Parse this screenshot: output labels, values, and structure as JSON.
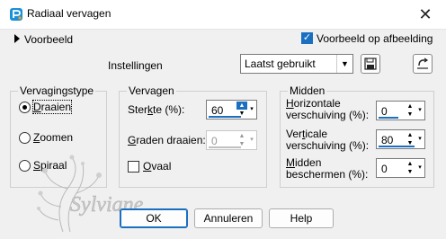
{
  "window": {
    "title": "Radiaal vervagen",
    "close_glyph": "✕",
    "icon": "paintshop-pro-icon"
  },
  "preview": {
    "toggle_label": "Voorbeeld",
    "on_image_label": "Voorbeeld op afbeelding",
    "on_image_checked": true
  },
  "settings": {
    "label": "Instellingen",
    "preset_value": "Laatst gebruikt",
    "save_icon": "save-icon",
    "reset_icon": "reset-icon"
  },
  "blur_type": {
    "title": "Vervagingstype",
    "options": [
      {
        "label_u": "D",
        "label_rest": "raaien",
        "checked": true
      },
      {
        "label_u": "Z",
        "label_rest": "oomen",
        "checked": false
      },
      {
        "label_u": "S",
        "label_rest": "piraal",
        "checked": false
      }
    ]
  },
  "blur": {
    "title": "Vervagen",
    "strength_label_pre": "Ster",
    "strength_label_u": "k",
    "strength_label_post": "te (%):",
    "strength_value": "60",
    "twist_label_u": "G",
    "twist_label_post": "raden draaien:",
    "twist_value": "0",
    "oval_label_u": "O",
    "oval_label_post": "vaal",
    "oval_checked": false
  },
  "center": {
    "title": "Midden",
    "h_offset_line1_u": "H",
    "h_offset_line1_rest": "orizontale",
    "h_offset_line2": "verschuiving (%):",
    "h_offset_value": "0",
    "v_offset_line1_pre": "Ver",
    "v_offset_line1_u": "t",
    "v_offset_line1_post": "icale",
    "v_offset_line2": "verschuiving (%):",
    "v_offset_value": "80",
    "protect_line1_u": "M",
    "protect_line1_rest": "idden",
    "protect_line2": "beschermen (%):",
    "protect_value": "0"
  },
  "buttons": {
    "ok": "OK",
    "cancel": "Annuleren",
    "help": "Help"
  },
  "watermark": {
    "text": "Sylviane"
  }
}
